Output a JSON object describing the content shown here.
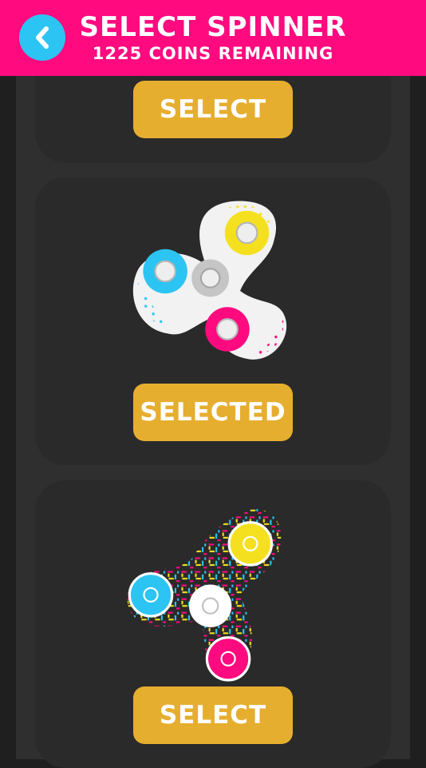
{
  "header": {
    "title": "SELECT SPINNER",
    "subtitle": "1225 COINS REMAINING",
    "back_icon": "chevron-left-icon",
    "color": "#ff0a7f"
  },
  "spinners": [
    {
      "button_label": "SELECT",
      "state": "locked"
    },
    {
      "button_label": "SELECTED",
      "state": "selected",
      "pattern": "white-dotted",
      "icon": "fidget-spinner-dots-icon"
    },
    {
      "button_label": "SELECT",
      "state": "locked",
      "pattern": "multicolor-weave",
      "icon": "fidget-spinner-weave-icon"
    }
  ],
  "colors": {
    "accent_pink": "#ff0a7f",
    "accent_cyan": "#2cc4f2",
    "accent_yellow": "#f5e020",
    "button": "#e6ae2f",
    "card": "#2a2a2a"
  }
}
